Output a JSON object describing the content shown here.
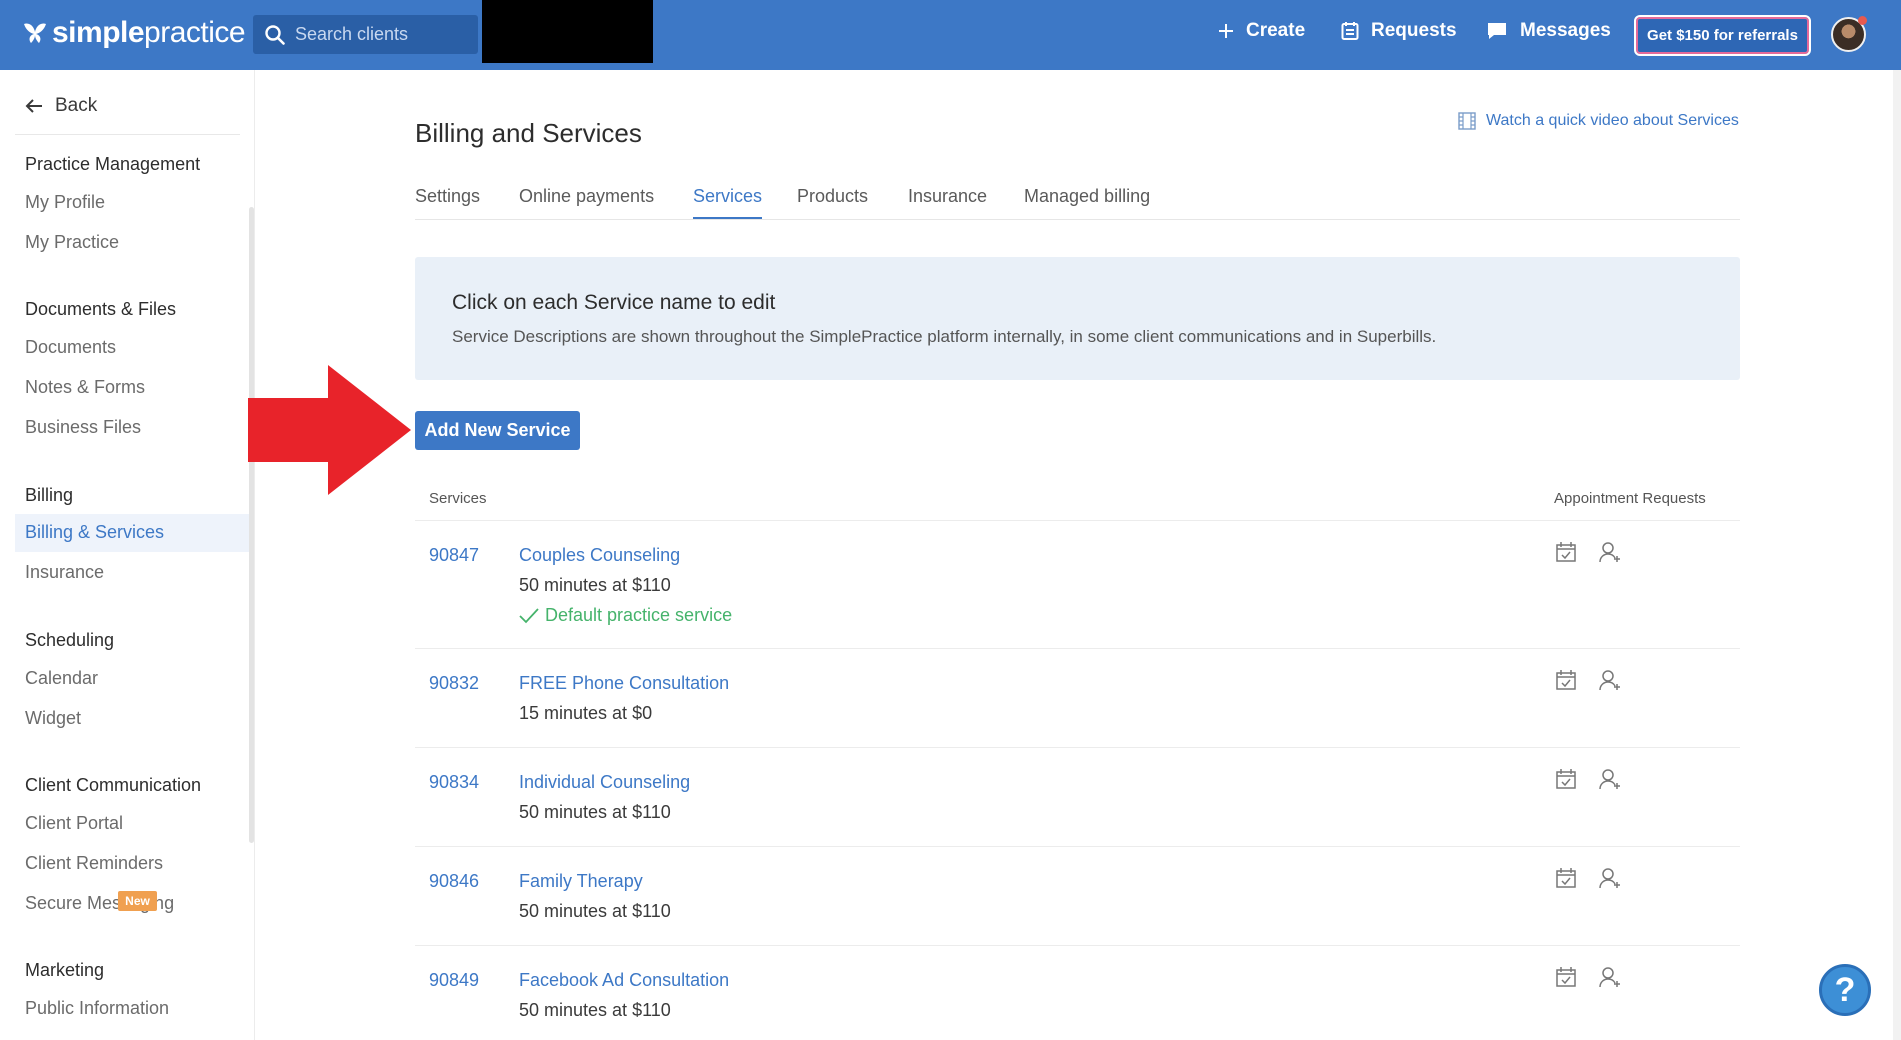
{
  "topbar": {
    "logo_bold": "simple",
    "logo_light": "practice",
    "search_placeholder": "Search clients",
    "create": "Create",
    "requests": "Requests",
    "messages": "Messages",
    "referral": "Get $150 for referrals"
  },
  "sidebar": {
    "back": "Back",
    "groups": [
      {
        "heading": "Practice Management",
        "items": [
          "My Profile",
          "My Practice"
        ]
      },
      {
        "heading": "Documents & Files",
        "items": [
          "Documents",
          "Notes & Forms",
          "Business Files"
        ]
      },
      {
        "heading": "Billing",
        "items": [
          "Billing & Services",
          "Insurance"
        ]
      },
      {
        "heading": "Scheduling",
        "items": [
          "Calendar",
          "Widget"
        ]
      },
      {
        "heading": "Client Communication",
        "items": [
          "Client Portal",
          "Client Reminders",
          "Secure Messaging"
        ]
      },
      {
        "heading": "Marketing",
        "badge": "New",
        "items": [
          "Public Information"
        ]
      }
    ],
    "active_item": "Billing & Services"
  },
  "main": {
    "title": "Billing and Services",
    "video_link": "Watch a quick video about Services",
    "tabs": [
      "Settings",
      "Online payments",
      "Services",
      "Products",
      "Insurance",
      "Managed billing"
    ],
    "active_tab": "Services",
    "info": {
      "title": "Click on each Service name to edit",
      "text": "Service Descriptions are shown throughout the SimplePractice platform internally, in some client communications and in Superbills."
    },
    "add_button": "Add New Service",
    "table": {
      "col_services": "Services",
      "col_requests": "Appointment Requests",
      "rows": [
        {
          "code": "90847",
          "name": "Couples Counseling",
          "duration": "50 minutes at $110",
          "default": "Default practice service"
        },
        {
          "code": "90832",
          "name": "FREE Phone Consultation",
          "duration": "15 minutes at $0"
        },
        {
          "code": "90834",
          "name": "Individual Counseling",
          "duration": "50 minutes at $110"
        },
        {
          "code": "90846",
          "name": "Family Therapy",
          "duration": "50 minutes at $110"
        },
        {
          "code": "90849",
          "name": "Facebook Ad Consultation",
          "duration": "50 minutes at $110"
        }
      ]
    }
  },
  "help": "?",
  "colors": {
    "brand": "#3d78c6",
    "success": "#45b36b",
    "arrow": "#e8232a",
    "info_bg": "#e9f0f8"
  }
}
